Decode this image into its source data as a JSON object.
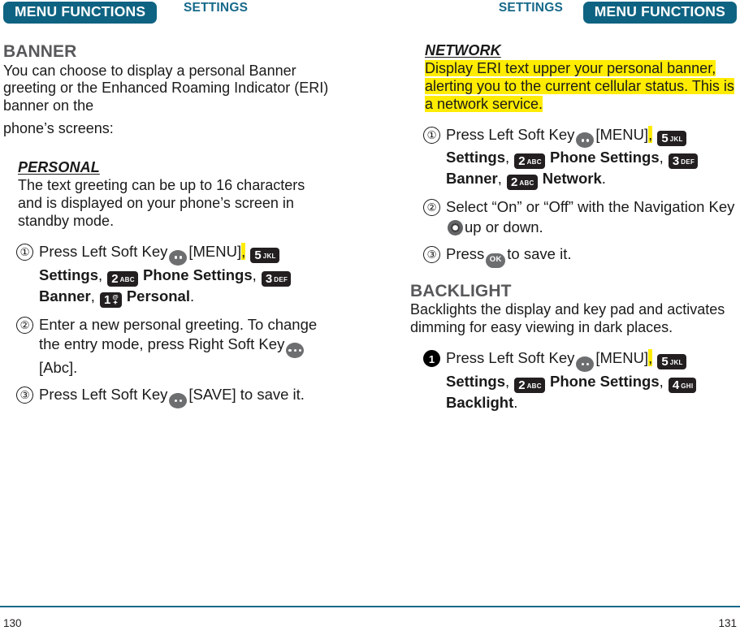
{
  "header": {
    "left_tab": "MENU FUNCTIONS",
    "left_plain": "SETTINGS",
    "right_plain": "SETTINGS",
    "right_tab": "MENU FUNCTIONS"
  },
  "colors": {
    "brand_teal": "#0f6382",
    "tab_text_teal": "#16698a",
    "highlight_yellow": "#ffec00",
    "heading_gray": "#58585a",
    "keycap_dark": "#231f20",
    "softkey_gray": "#6d6e70"
  },
  "left_column": {
    "section_title": "BANNER",
    "intro": "You can choose to display a personal Banner greeting or the Enhanced Roaming Indicator (ERI) banner on the",
    "intro2": "phone’s screens:",
    "subsection_title": "PERSONAL",
    "subsection_text": "The text greeting can be up to 16 characters and is displayed on your phone’s screen in standby mode.",
    "steps": [
      {
        "num": "①",
        "marker_style": "outline",
        "parts": {
          "t1": "Press Left Soft Key",
          "softkey": "left-soft-key-icon",
          "t2": "[MENU]",
          "comma_hl": ",",
          "k1_num": "5",
          "k1_sub": "JKL",
          "b1": "Settings",
          "c1": ",",
          "k2_num": "2",
          "k2_sub": "ABC",
          "b2": "Phone Settings",
          "c2": ",",
          "k3_num": "3",
          "k3_sub": "DEF",
          "b3": "Banner",
          "c3": ",",
          "k4_num": "1",
          "k4_sub_top": "@",
          "k4_sub_bot": "✦",
          "b4": "Personal",
          "c4": "."
        }
      },
      {
        "num": "②",
        "marker_style": "outline",
        "parts": {
          "t1": "Enter a new personal greeting. To change the entry mode, press Right Soft Key",
          "softkey": "right-soft-key-icon",
          "t2": "[Abc]."
        }
      },
      {
        "num": "③",
        "marker_style": "outline",
        "parts": {
          "t1": "Press Left Soft Key",
          "softkey": "left-soft-key-icon",
          "t2": "[SAVE] to save it."
        }
      }
    ]
  },
  "right_column": {
    "subsection_title": "NETWORK",
    "highlight_text": "Display ERI text upper your personal banner, alerting you to the current cellular status. This is a network service.",
    "steps": [
      {
        "num": "①",
        "marker_style": "outline",
        "parts": {
          "t1": "Press Left Soft Key",
          "softkey": "left-soft-key-icon",
          "t2": "[MENU]",
          "comma_hl": ",",
          "k1_num": "5",
          "k1_sub": "JKL",
          "b1": "Settings",
          "c1": ",",
          "k2_num": "2",
          "k2_sub": "ABC",
          "b2": "Phone Settings",
          "c2": ",",
          "k3_num": "3",
          "k3_sub": "DEF",
          "b3": "Banner",
          "c3": ",",
          "k4_num": "2",
          "k4_sub": "ABC",
          "b4": "Network",
          "c4": "."
        }
      },
      {
        "num": "②",
        "marker_style": "outline",
        "parts": {
          "t1": "Select “On” or “Off” with the Navigation Key",
          "navkey": "navigation-key-icon",
          "t2": "up or down."
        }
      },
      {
        "num": "③",
        "marker_style": "outline",
        "parts": {
          "t1": "Press",
          "okkey": "OK",
          "t2": "to save it."
        }
      }
    ],
    "section_title": "BACKLIGHT",
    "section_text": "Backlights the display and key pad and activates dimming for easy viewing in dark places.",
    "backlight_steps": [
      {
        "num": "1",
        "marker_style": "filled",
        "parts": {
          "t1": "Press Left Soft Key",
          "softkey": "left-soft-key-icon",
          "t2": "[MENU]",
          "comma_hl": ",",
          "k1_num": "5",
          "k1_sub": "JKL",
          "b1": "Settings",
          "c1": ",",
          "k2_num": "2",
          "k2_sub": "ABC",
          "b2": "Phone Settings",
          "c2": ",",
          "k3_num": "4",
          "k3_sub": "GHI",
          "b3": "Backlight",
          "c3": "."
        }
      }
    ]
  },
  "footer": {
    "page_left": "130",
    "page_right": "131"
  }
}
